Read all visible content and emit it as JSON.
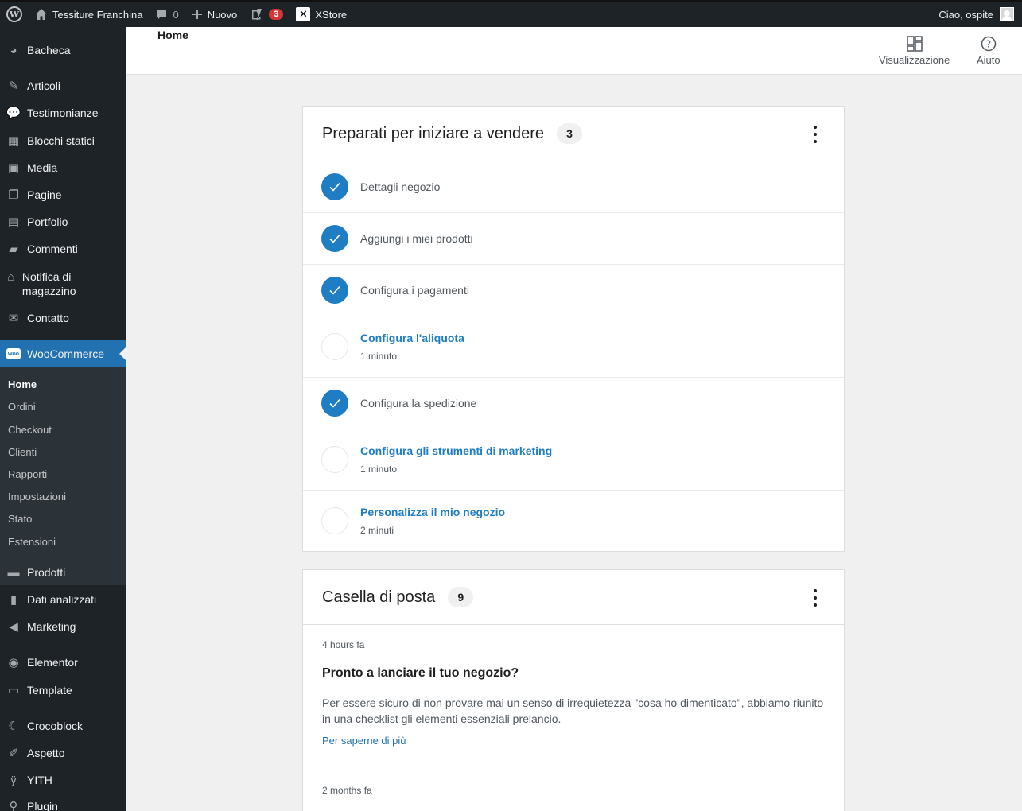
{
  "adminbar": {
    "site_name": "Tessiture Franchina",
    "comments_count": "0",
    "new_label": "Nuovo",
    "yoast_count": "3",
    "xstore_label": "XStore",
    "greeting": "Ciao, ospite"
  },
  "sidebar": {
    "items": [
      {
        "label": "Bacheca",
        "icon": "dashboard-icon"
      },
      {
        "label": "Articoli",
        "icon": "pin-icon"
      },
      {
        "label": "Testimonianze",
        "icon": "chat-icon"
      },
      {
        "label": "Blocchi statici",
        "icon": "table-icon"
      },
      {
        "label": "Media",
        "icon": "media-icon"
      },
      {
        "label": "Pagine",
        "icon": "pages-icon"
      },
      {
        "label": "Portfolio",
        "icon": "portfolio-icon"
      },
      {
        "label": "Commenti",
        "icon": "comment-icon"
      },
      {
        "label": "Notifica di magazzino",
        "icon": "bank-icon"
      },
      {
        "label": "Contatto",
        "icon": "mail-icon"
      },
      {
        "label": "WooCommerce",
        "icon": "woo-icon"
      },
      {
        "label": "Prodotti",
        "icon": "archive-icon"
      },
      {
        "label": "Dati analizzati",
        "icon": "bar-chart-icon"
      },
      {
        "label": "Marketing",
        "icon": "megaphone-icon"
      },
      {
        "label": "Elementor",
        "icon": "elementor-icon"
      },
      {
        "label": "Template",
        "icon": "folder-icon"
      },
      {
        "label": "Crocoblock",
        "icon": "crocoblock-icon"
      },
      {
        "label": "Aspetto",
        "icon": "brush-icon"
      },
      {
        "label": "YITH",
        "icon": "yith-icon"
      },
      {
        "label": "Plugin",
        "icon": "plugin-icon"
      }
    ],
    "submenu": [
      "Home",
      "Ordini",
      "Checkout",
      "Clienti",
      "Rapporti",
      "Impostazioni",
      "Stato",
      "Estensioni"
    ]
  },
  "header": {
    "title": "Home",
    "display_label": "Visualizzazione",
    "help_label": "Aiuto"
  },
  "setup": {
    "title": "Preparati per iniziare a vendere",
    "count": "3",
    "tasks": [
      {
        "label": "Dettagli negozio",
        "done": true
      },
      {
        "label": "Aggiungi i miei prodotti",
        "done": true
      },
      {
        "label": "Configura i pagamenti",
        "done": true
      },
      {
        "label": "Configura l'aliquota",
        "done": false,
        "time": "1 minuto"
      },
      {
        "label": "Configura la spedizione",
        "done": true
      },
      {
        "label": "Configura gli strumenti di marketing",
        "done": false,
        "time": "1 minuto"
      },
      {
        "label": "Personalizza il mio negozio",
        "done": false,
        "time": "2 minuti"
      }
    ]
  },
  "inbox": {
    "title": "Casella di posta",
    "count": "9",
    "notes": [
      {
        "date": "4 hours fa",
        "title": "Pronto a lanciare il tuo negozio?",
        "body": "Per essere sicuro di non provare mai un senso di irrequietezza \"cosa ho dimenticato\", abbiamo riunito in una checklist gli elementi essenziali prelancio.",
        "link": "Per saperne di più"
      },
      {
        "date": "2 months fa"
      }
    ]
  }
}
